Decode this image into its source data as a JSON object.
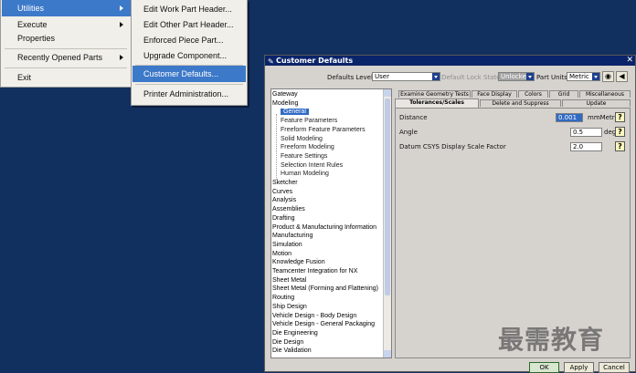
{
  "menu_left": [
    {
      "label": "Utilities",
      "submenu": true,
      "active": true
    },
    {
      "label": "Execute",
      "submenu": true
    },
    {
      "label": "Properties",
      "submenu": false
    },
    {
      "label": "Recently Opened Parts",
      "submenu": true
    },
    {
      "label": "Exit",
      "submenu": false
    }
  ],
  "menu_right": [
    {
      "label": "Edit Work Part Header..."
    },
    {
      "label": "Edit Other Part Header..."
    },
    {
      "label": "Enforced Piece Part..."
    },
    {
      "label": "Upgrade Component..."
    },
    {
      "label": "Customer Defaults...",
      "active": true
    },
    {
      "label": "Printer Administration..."
    }
  ],
  "dialog": {
    "title": "Customer Defaults",
    "defaults_level_label": "Defaults Level",
    "defaults_level_value": "User",
    "default_lock_state_label": "Default Lock State",
    "default_lock_state_value": "Unlocked",
    "part_units_label": "Part Units",
    "part_units_value": "Metric"
  },
  "tree": [
    {
      "label": "Gateway",
      "level": 0
    },
    {
      "label": "Modeling",
      "level": 0
    },
    {
      "label": "General",
      "level": 1,
      "selected": true
    },
    {
      "label": "Feature Parameters",
      "level": 1
    },
    {
      "label": "Freeform Feature Parameters",
      "level": 1
    },
    {
      "label": "Solid Modeling",
      "level": 1
    },
    {
      "label": "Freeform Modeling",
      "level": 1
    },
    {
      "label": "Feature Settings",
      "level": 1
    },
    {
      "label": "Selection Intent Rules",
      "level": 1
    },
    {
      "label": "Human Modeling",
      "level": 1
    },
    {
      "label": "Sketcher",
      "level": 0
    },
    {
      "label": "Curves",
      "level": 0
    },
    {
      "label": "Analysis",
      "level": 0
    },
    {
      "label": "Assemblies",
      "level": 0
    },
    {
      "label": "Drafting",
      "level": 0
    },
    {
      "label": "Product & Manufacturing Information",
      "level": 0
    },
    {
      "label": "Manufacturing",
      "level": 0
    },
    {
      "label": "Simulation",
      "level": 0
    },
    {
      "label": "Motion",
      "level": 0
    },
    {
      "label": "Knowledge Fusion",
      "level": 0
    },
    {
      "label": "Teamcenter Integration for NX",
      "level": 0
    },
    {
      "label": "Sheet Metal",
      "level": 0
    },
    {
      "label": "Sheet Metal (Forming and Flattening)",
      "level": 0
    },
    {
      "label": "Routing",
      "level": 0
    },
    {
      "label": "Ship Design",
      "level": 0
    },
    {
      "label": "Vehicle Design - Body Design",
      "level": 0
    },
    {
      "label": "Vehicle Design - General Packaging",
      "level": 0
    },
    {
      "label": "Die Engineering",
      "level": 0
    },
    {
      "label": "Die Design",
      "level": 0
    },
    {
      "label": "Die Validation",
      "level": 0
    }
  ],
  "tabs_row1": [
    "Examine Geometry Tests",
    "Face Display",
    "Colors",
    "Grid",
    "Miscellaneous"
  ],
  "tabs_row2": [
    "Tolerances/Scales",
    "Delete and Suppress",
    "Update"
  ],
  "fields": {
    "distance_label": "Distance",
    "distance_value": "0.001",
    "distance_unit": "mmMetric",
    "angle_label": "Angle",
    "angle_value": "0.5",
    "angle_unit": "deg",
    "datum_label": "Datum CSYS Display Scale Factor",
    "datum_value": "2.0",
    "help_glyph": "?"
  },
  "buttons": {
    "ok": "OK",
    "apply": "Apply",
    "cancel": "Cancel"
  },
  "watermark": "最需教育",
  "colors": {
    "desktop": "#12305f",
    "highlight": "#3d79c9",
    "title_bar": "#0a246a"
  }
}
